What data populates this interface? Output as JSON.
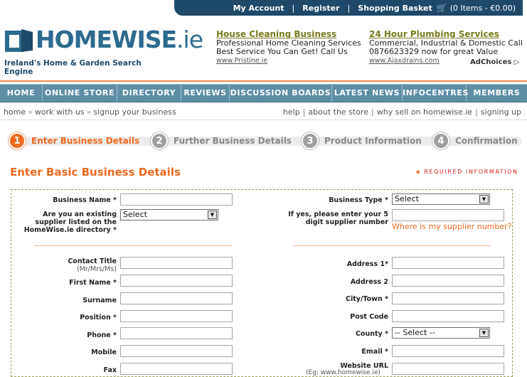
{
  "topbar": {
    "my_account": "My Account",
    "register": "Register",
    "shopping_basket": "Shopping Basket",
    "basket_items": "(0 Items - €0.00)"
  },
  "brand": {
    "logo_text": "HOMEWISE",
    "logo_suffix": ".ie",
    "tagline": "Ireland's Home & Garden Search Engine",
    "primary_color": "#1e4968",
    "accent_color": "#ef6a20"
  },
  "ads": [
    {
      "title": "House Cleaning Business",
      "line1": "Professional Home Cleaning Services",
      "line2": "Best Service You Can Get! Call Us",
      "url": "www.Pristine.ie"
    },
    {
      "title": "24 Hour Plumbing Services",
      "line1": "Commercial, Industrial & Domestic Call",
      "line2": "0876623329 now for great Value",
      "url": "www.Ajaxdrains.com"
    }
  ],
  "adchoices": "AdChoices ▷",
  "nav": [
    "HOME",
    "ONLINE STORE",
    "DIRECTORY",
    "REVIEWS",
    "DISCUSSION BOARDS",
    "LATEST NEWS",
    "INFOCENTRES",
    "MEMBERS"
  ],
  "breadcrumb": [
    "home",
    "work with us",
    "signup your business"
  ],
  "utility_links": [
    "help",
    "about the store",
    "why sell on homewise.ie",
    "signing up"
  ],
  "steps": [
    {
      "num": "1",
      "label": "Enter Business Details",
      "active": true
    },
    {
      "num": "2",
      "label": "Further Business Details",
      "active": false
    },
    {
      "num": "3",
      "label": "Product Information",
      "active": false
    },
    {
      "num": "4",
      "label": "Confirmation",
      "active": false
    }
  ],
  "form": {
    "heading": "Enter Basic Business Details",
    "required_note": "REQUIRED INFORMATION",
    "business_name": "Business Name",
    "existing_supplier": "Are you an existing supplier listed on the HomeWise.ie directory",
    "existing_supplier_value": "Select",
    "business_type": "Business Type",
    "business_type_value": "Select",
    "supplier_number": "If yes, please enter your 5 digit supplier number",
    "supplier_number_help": "Where is my supplier number?",
    "contact_title": "Contact Title",
    "contact_title_sub": "(Mr/Mrs/Ms)",
    "first_name": "First Name",
    "surname": "Surname",
    "position": "Position",
    "phone": "Phone",
    "mobile": "Mobile",
    "fax": "Fax",
    "address1": "Address 1",
    "address2": "Address 2",
    "city": "City/Town",
    "post_code": "Post Code",
    "county": "County",
    "county_value": "-- Select --",
    "email": "Email",
    "website": "Website URL",
    "website_hint": "(Eg: www.homewise.ie)"
  }
}
